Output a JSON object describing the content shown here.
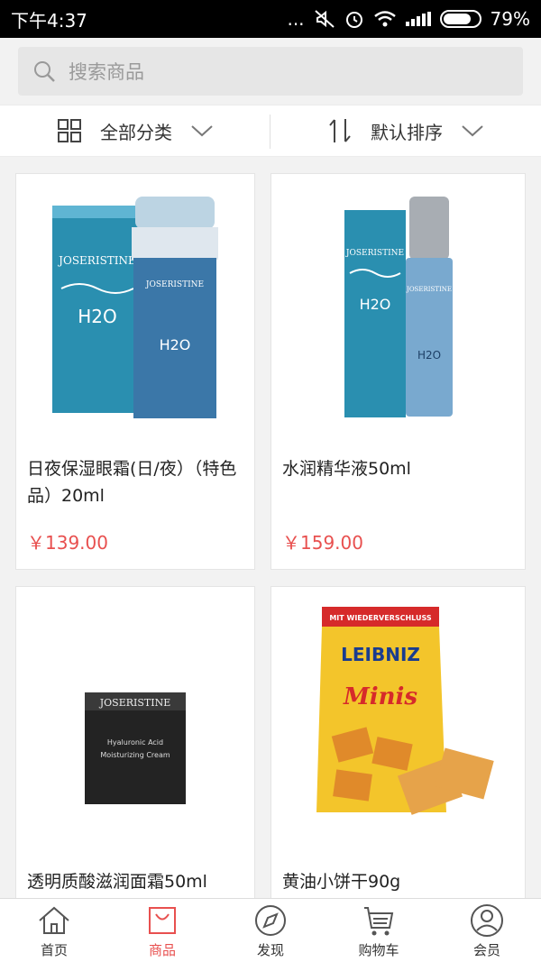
{
  "status": {
    "time": "下午4:37",
    "dots": "...",
    "battery": "79%",
    "battery_level": 0.79
  },
  "search": {
    "placeholder": "搜索商品"
  },
  "filters": {
    "category_label": "全部分类",
    "sort_label": "默认排序"
  },
  "products": [
    {
      "name": "日夜保湿眼霜(日/夜）（特色品）20ml",
      "price": "￥139.00",
      "image": "eye-cream-box",
      "box_brand": "JOSERISTINE",
      "box_text_1": "H2O"
    },
    {
      "name": "水润精华液50ml",
      "price": "￥159.00",
      "image": "essence-bottle-box",
      "box_brand": "JOSERISTINE",
      "box_text_1": "H2O"
    },
    {
      "name": "透明质酸滋润面霜50ml",
      "price": "",
      "image": "face-cream-jar",
      "box_brand": "JOSERISTINE",
      "box_text_1": "Hyaluronic Acid",
      "box_text_2": "Moisturizing Cream"
    },
    {
      "name": "黄油小饼干90g",
      "price": "",
      "image": "biscuit-bag",
      "box_brand": "LEIBNIZ",
      "box_text_1": "Minis",
      "box_text_2": "MIT WIEDERVERSCHLUSS"
    }
  ],
  "tabs": [
    {
      "label": "首页",
      "icon": "home-icon",
      "active": false
    },
    {
      "label": "商品",
      "icon": "bag-icon",
      "active": true
    },
    {
      "label": "发现",
      "icon": "compass-icon",
      "active": false
    },
    {
      "label": "购物车",
      "icon": "cart-icon",
      "active": false
    },
    {
      "label": "会员",
      "icon": "member-icon",
      "active": false
    }
  ],
  "colors": {
    "accent": "#e8504f",
    "teal": "#2a8fb0"
  }
}
